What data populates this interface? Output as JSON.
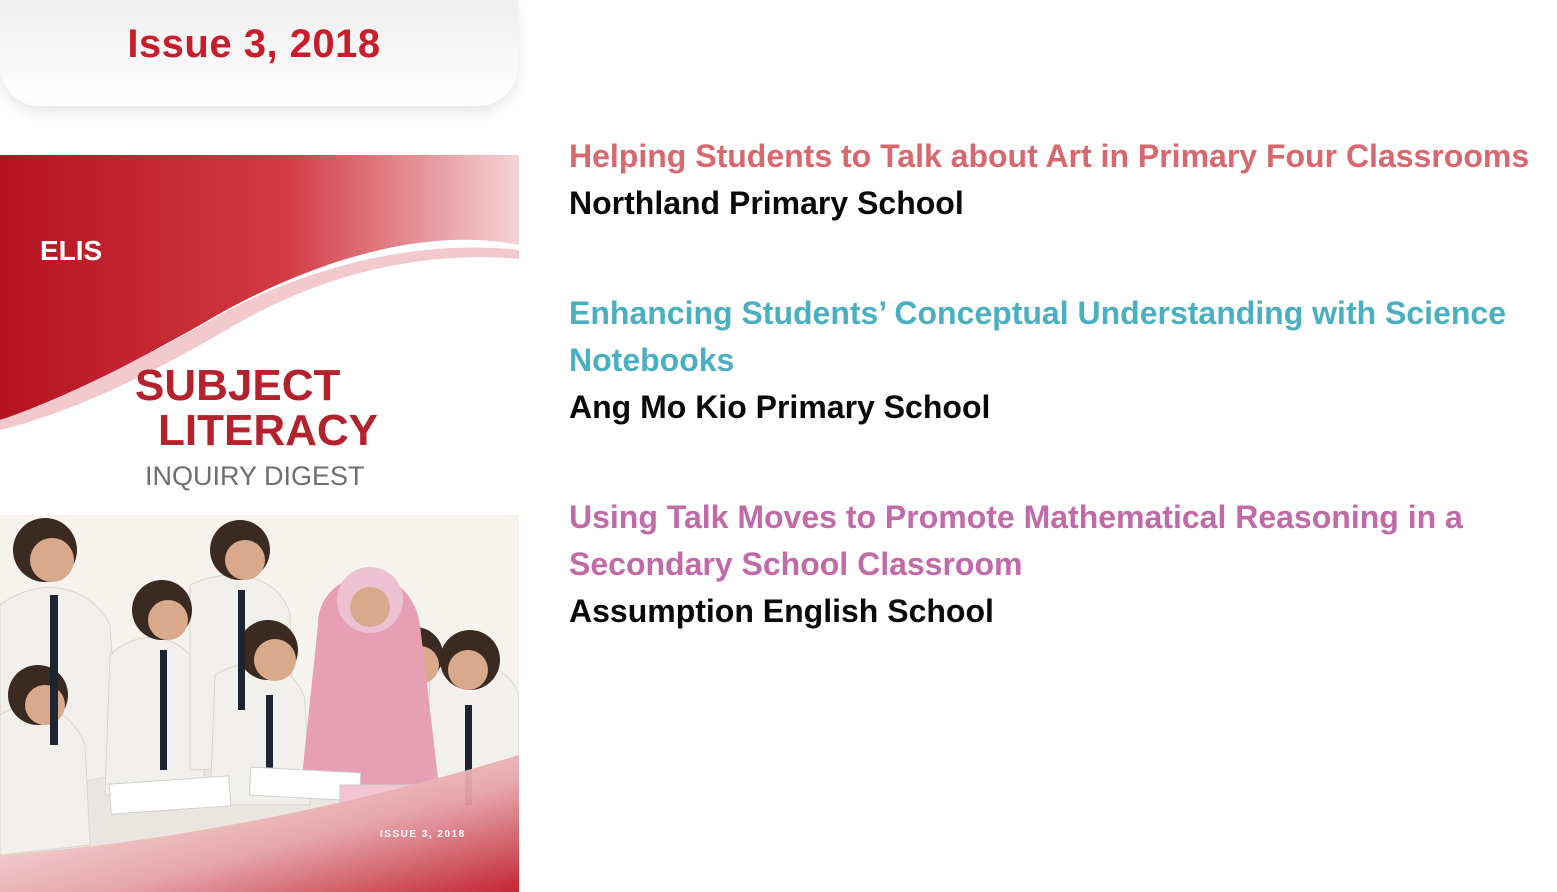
{
  "issue": {
    "label": "Issue 3, 2018",
    "color": "#c81e2c"
  },
  "cover": {
    "logo": "ELIS",
    "title_line1": "SUBJECT",
    "title_line2": "LITERACY",
    "subtitle": "INQUIRY DIGEST",
    "issue_label": "ISSUE 3, 2018",
    "accent_color": "#c8202e"
  },
  "articles": [
    {
      "title": "Helping Students to Talk about Art in Primary Four Classrooms",
      "school": "Northland Primary School",
      "color": "#d9686e"
    },
    {
      "title": "Enhancing Students’ Conceptual Understanding with Science Notebooks",
      "school": "Ang Mo Kio Primary School",
      "color": "#4aafc0"
    },
    {
      "title": "Using Talk Moves to Promote Mathematical Reasoning in a Secondary School Classroom",
      "school": "Assumption English School",
      "color": "#c06aa8"
    }
  ]
}
